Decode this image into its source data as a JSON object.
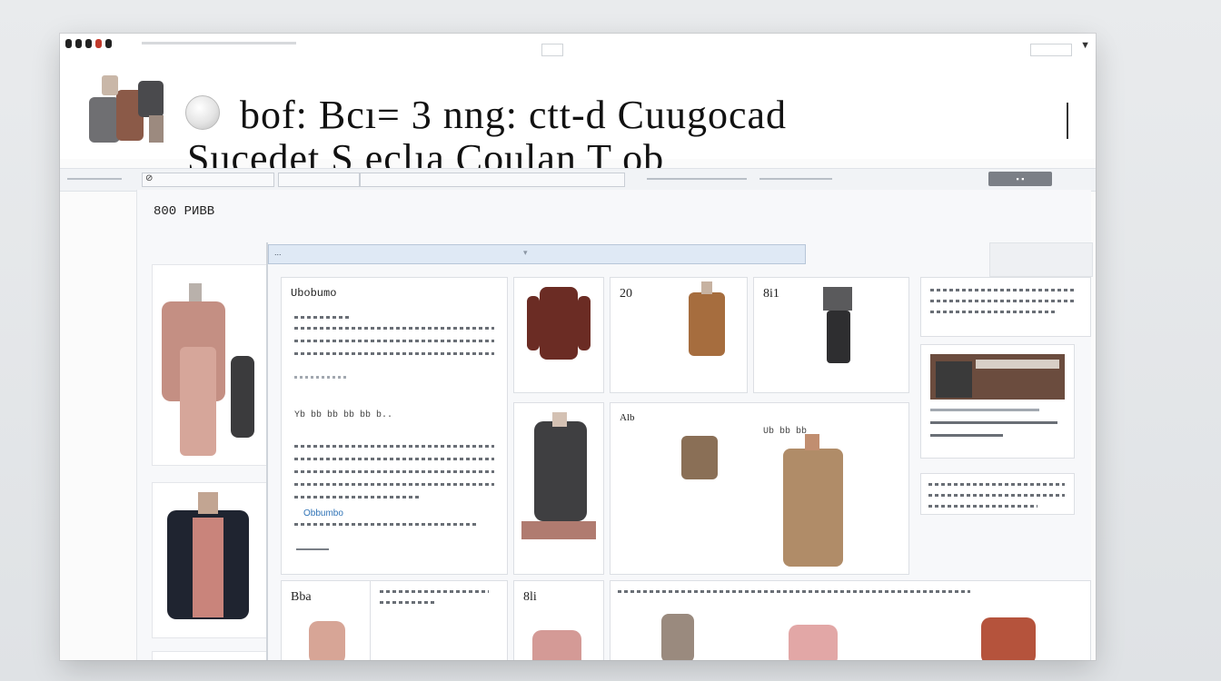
{
  "window": {
    "hero_title_line1": "bof: Bcı= 3 nng: ctt-d Cuugocad",
    "hero_title_line2": "Sucedet S eclıa Coulan T ob"
  },
  "nav": {
    "button_label": "▪ ▪"
  },
  "sidebar": {
    "title": "800 РИВВ"
  },
  "toolbar": {
    "text": "...",
    "caret": "▾"
  },
  "cards": {
    "info": {
      "title": "Ubobumo",
      "subtitle": "Yb bb bb bb bb b..",
      "link": "Obbumbo"
    },
    "product_b": {
      "label": "20"
    },
    "product_c": {
      "label": "8i1"
    },
    "feature": {
      "label": "Alb",
      "inner_label": "Ub bb bb"
    },
    "bottom_a": {
      "label": "Bba"
    },
    "bottom_b": {
      "label": "8li"
    }
  },
  "icons": {
    "hero": "clothing-collage-icon",
    "search": "search-icon",
    "window_dots": "window-controls-icon"
  },
  "colors": {
    "accent": "#2f73b6",
    "toolbar": "#dfe9f5",
    "nav_button": "#7b7f86"
  }
}
